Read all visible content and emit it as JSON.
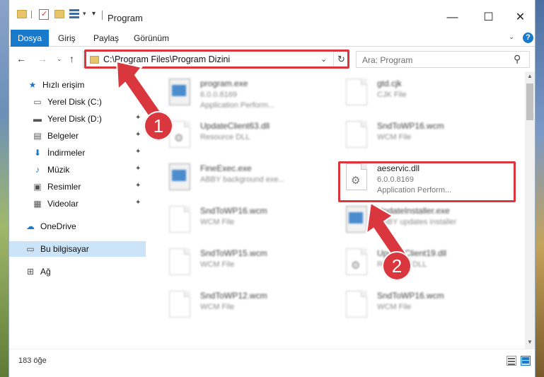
{
  "window": {
    "title": "Program",
    "minimize": "—",
    "maximize": "☐",
    "close": "✕"
  },
  "ribbon": {
    "tabs": [
      "Dosya",
      "Giriş",
      "Paylaş",
      "Görünüm"
    ],
    "expand": "⌄",
    "help": "?"
  },
  "navigation": {
    "back": "←",
    "forward": "→",
    "recent": "⌄",
    "up": "↑"
  },
  "address": {
    "path": "C:\\Program Files\\Program Dizini",
    "dropdown": "⌄",
    "refresh": "↻"
  },
  "search": {
    "placeholder": "Ara: Program",
    "icon": "⚲"
  },
  "sidebar": {
    "items": [
      {
        "label": "Hızlı erişim",
        "icon": "star-icon",
        "glyph": "★",
        "pinned": false
      },
      {
        "label": "Yerel Disk (C:)",
        "icon": "drive-icon",
        "glyph": "▭",
        "pinned": true
      },
      {
        "label": "Yerel Disk (D:)",
        "icon": "drive-icon",
        "glyph": "▬",
        "pinned": true
      },
      {
        "label": "Belgeler",
        "icon": "documents-icon",
        "glyph": "▤",
        "pinned": true
      },
      {
        "label": "İndirmeler",
        "icon": "download-icon",
        "glyph": "⬇",
        "pinned": true
      },
      {
        "label": "Müzik",
        "icon": "music-icon",
        "glyph": "♪",
        "pinned": true
      },
      {
        "label": "Resimler",
        "icon": "pictures-icon",
        "glyph": "▣",
        "pinned": true
      },
      {
        "label": "Videolar",
        "icon": "video-icon",
        "glyph": "▦",
        "pinned": true
      },
      {
        "label": "OneDrive",
        "icon": "cloud-icon",
        "glyph": "☁",
        "pinned": false
      },
      {
        "label": "Bu bilgisayar",
        "icon": "computer-icon",
        "glyph": "▭",
        "pinned": false
      },
      {
        "label": "Ağ",
        "icon": "network-icon",
        "glyph": "⊞",
        "pinned": false
      }
    ],
    "pin_glyph": "📌"
  },
  "files": {
    "focused": {
      "name": "aeservic.dll",
      "version": "6.0.0.8169",
      "type": "Application Perform..."
    },
    "left_column": [
      {
        "name": "program.exe",
        "line2": "6.0.0.8169",
        "line3": "Application Perform..."
      },
      {
        "name": "UpdateClient63.dll",
        "line2": "Resource DLL",
        "line3": ""
      },
      {
        "name": "FineExec.exe",
        "line2": "ABBY background exe...",
        "line3": ""
      },
      {
        "name": "SndToWP16.wcm",
        "line2": "WCM File",
        "line3": ""
      },
      {
        "name": "SndToWP15.wcm",
        "line2": "WCM File",
        "line3": ""
      },
      {
        "name": "SndToWP12.wcm",
        "line2": "WCM File",
        "line3": ""
      }
    ],
    "right_column": [
      {
        "name": "gtd.cjk",
        "line2": "CJK File",
        "line3": ""
      },
      {
        "name": "SndToWP16.wcm",
        "line2": "WCM File",
        "line3": ""
      },
      {
        "name": "UpdateInstaller.exe",
        "line2": "ABBY updates installer",
        "line3": ""
      },
      {
        "name": "UpdateClient19.dll",
        "line2": "Resource DLL",
        "line3": ""
      },
      {
        "name": "SndToWP16.wcm",
        "line2": "WCM File",
        "line3": ""
      }
    ]
  },
  "status": {
    "count": "183 öğe"
  },
  "callouts": [
    "1",
    "2"
  ],
  "colors": {
    "accent": "#1979ca",
    "highlight": "#d9363e",
    "selected": "#cce4f7"
  }
}
